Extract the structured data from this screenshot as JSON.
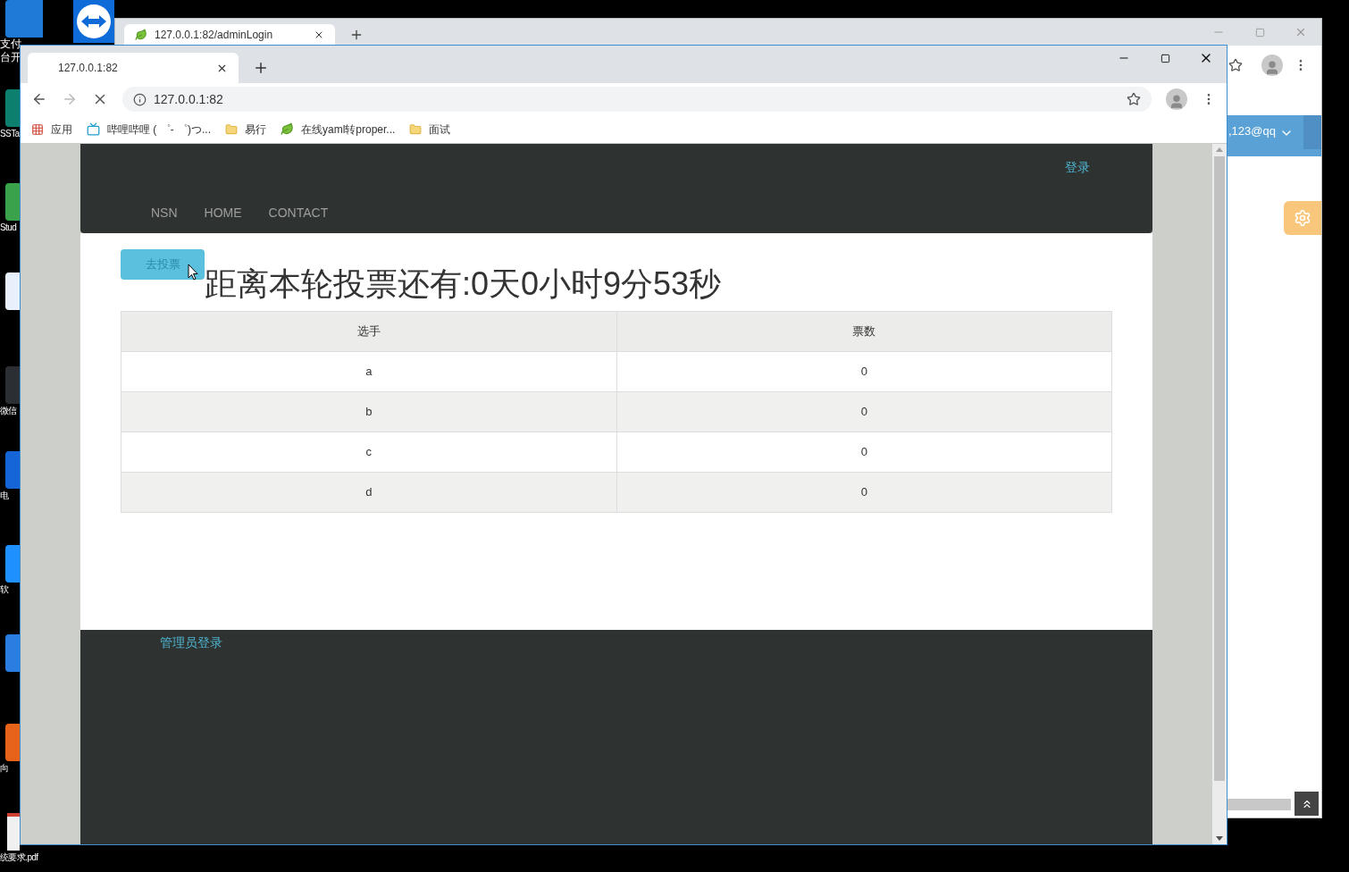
{
  "desktop_icons": [
    {
      "kind": "shortcut",
      "lines": [
        "支付",
        "台开"
      ]
    },
    {
      "kind": "shortcut",
      "lines": [
        "SSTa"
      ]
    },
    {
      "kind": "shortcut",
      "lines": [
        "Stud"
      ]
    },
    {
      "kind": "shortcut"
    },
    {
      "kind": "shortcut",
      "lines": [
        "微信"
      ]
    },
    {
      "kind": "shortcut",
      "lines": [
        "电"
      ]
    },
    {
      "kind": "shortcut",
      "lines": [
        "软"
      ]
    },
    {
      "kind": "shortcut"
    },
    {
      "kind": "shortcut",
      "lines": [
        "向"
      ]
    },
    {
      "kind": "file",
      "lines": [
        "统要求.pdf"
      ]
    }
  ],
  "back_window": {
    "tab_title": "127.0.0.1:82/adminLogin",
    "account": ",123@qq"
  },
  "window": {
    "tab_title": "127.0.0.1:82",
    "url": "127.0.0.1:82"
  },
  "bookmarks": [
    {
      "kind": "apps",
      "label": "应用"
    },
    {
      "kind": "site",
      "label": "哔哩哔哩 ( ゜- ゜)つ..."
    },
    {
      "kind": "folder",
      "label": "易行"
    },
    {
      "kind": "leaf",
      "label": "在线yaml转proper..."
    },
    {
      "kind": "folder",
      "label": "面试"
    }
  ],
  "page": {
    "login_link": "登录",
    "nav": [
      "NSN",
      "HOME",
      "CONTACT"
    ],
    "vote_button": "去投票",
    "countdown": "距离本轮投票还有:0天0小时9分53秒",
    "table": {
      "columns": [
        "选手",
        "票数"
      ],
      "rows": [
        [
          "a",
          "0"
        ],
        [
          "b",
          "0"
        ],
        [
          "c",
          "0"
        ],
        [
          "d",
          "0"
        ]
      ]
    },
    "admin_link": "管理员登录"
  }
}
